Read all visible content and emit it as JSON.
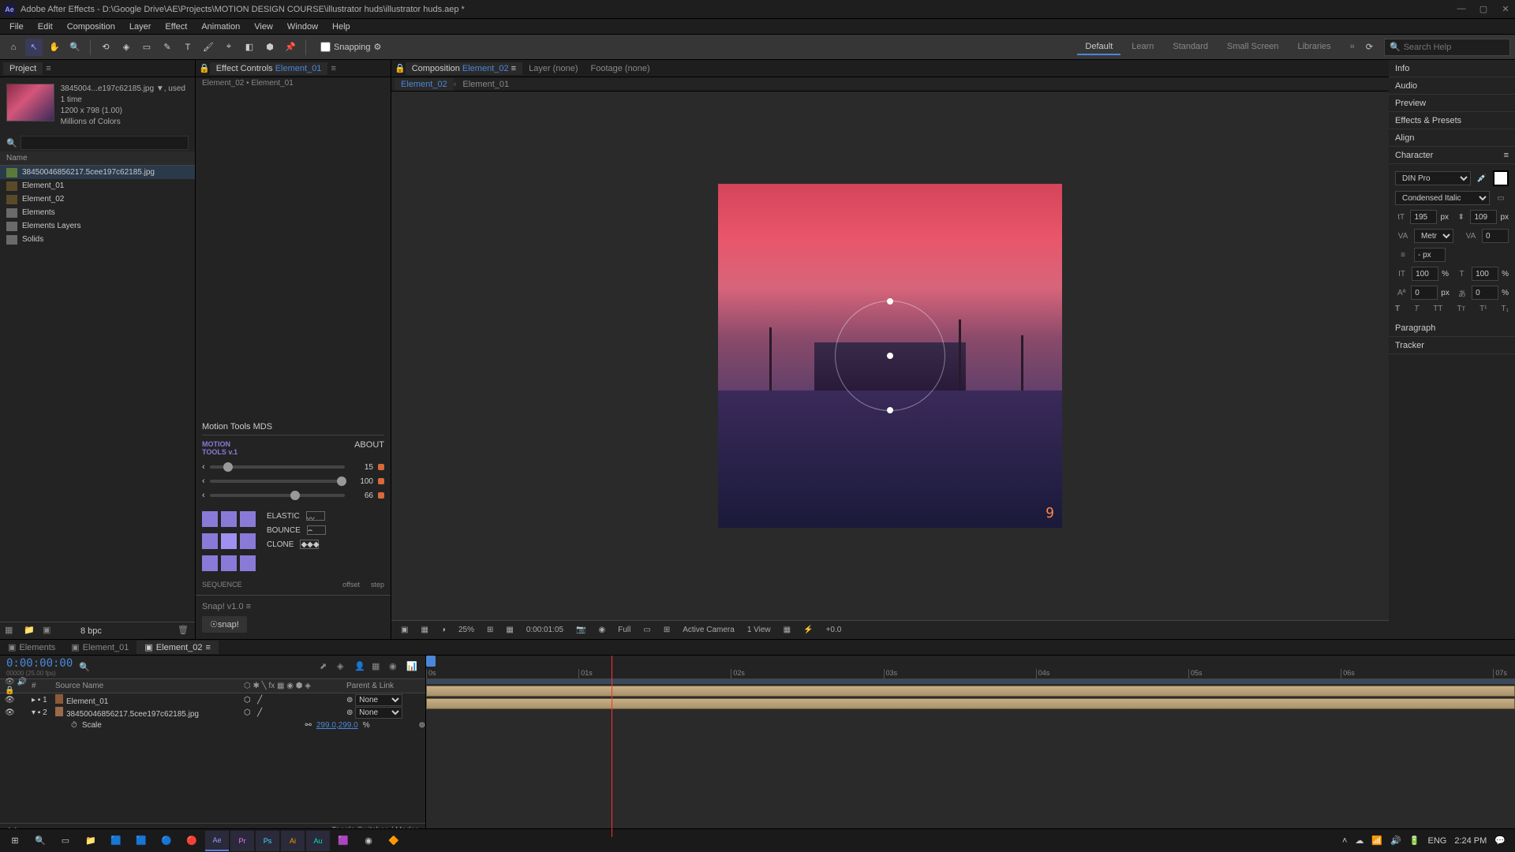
{
  "window": {
    "title": "Adobe After Effects - D:\\Google Drive\\AE\\Projects\\MOTION DESIGN COURSE\\illustrator huds\\illustrator huds.aep *",
    "app_icon": "Ae"
  },
  "menu": [
    "File",
    "Edit",
    "Composition",
    "Layer",
    "Effect",
    "Animation",
    "View",
    "Window",
    "Help"
  ],
  "toolbar": {
    "snapping_label": "Snapping"
  },
  "workspaces": [
    "Default",
    "Learn",
    "Standard",
    "Small Screen",
    "Libraries"
  ],
  "search_placeholder": "Search Help",
  "project": {
    "tab_label": "Project",
    "thumb_name": "3845004...e197c62185.jpg ▼",
    "thumb_info1": ", used 1 time",
    "thumb_info2": "1200 x 798 (1.00)",
    "thumb_info3": "Millions of Colors",
    "list_header": "Name",
    "items": [
      {
        "name": "38450046856217.5cee197c62185.jpg",
        "type": "img",
        "selected": true
      },
      {
        "name": "Element_01",
        "type": "comp"
      },
      {
        "name": "Element_02",
        "type": "comp"
      },
      {
        "name": "Elements",
        "type": "folder"
      },
      {
        "name": "Elements Layers",
        "type": "folder"
      },
      {
        "name": "Solids",
        "type": "folder"
      }
    ],
    "footer_bpc": "8 bpc"
  },
  "fx": {
    "tab_label": "Effect Controls",
    "tab_context": "Element_01",
    "breadcrumb": "Element_02 • Element_01"
  },
  "motion_tools": {
    "title": "Motion Tools MDS",
    "logo_l1": "MOTION",
    "logo_l2": "TOOLS v.1",
    "about": "ABOUT",
    "rows": [
      {
        "val": "15",
        "pos": 10
      },
      {
        "val": "100",
        "pos": 98
      },
      {
        "val": "66",
        "pos": 60
      }
    ],
    "presets": [
      "ELASTIC",
      "BOUNCE",
      "CLONE"
    ],
    "seq_label1": "offset",
    "seq_label2": "step",
    "seq_title": "SEQUENCE"
  },
  "snap": {
    "title": "Snap! v1.0",
    "btn": "☉snap!"
  },
  "comp_tabs": {
    "comp_label": "Composition",
    "comp_active": "Element_02",
    "layer_label": "Layer (none)",
    "footage_label": "Footage (none)",
    "sub1": "Element_02",
    "sub2": "Element_01"
  },
  "comp_footer": {
    "zoom": "25%",
    "time": "0:00:01:05",
    "res": "Full",
    "camera": "Active Camera",
    "views": "1 View",
    "exposure": "+0.0"
  },
  "side_panels": [
    "Info",
    "Audio",
    "Preview",
    "Effects & Presets",
    "Align"
  ],
  "character": {
    "title": "Character",
    "font": "DIN Pro",
    "style": "Condensed Italic",
    "size": "195",
    "leading": "109",
    "size_unit": "px",
    "kerning": "Metrics",
    "tracking": "0",
    "px_unit": "- px",
    "hscale": "100",
    "vscale": "100",
    "baseline": "0",
    "tsume": "0"
  },
  "paragraph": {
    "title": "Paragraph"
  },
  "tracker": {
    "title": "Tracker"
  },
  "timeline": {
    "tabs": [
      "Elements",
      "Element_01",
      "Element_02"
    ],
    "timecode": "0:00:00:00",
    "timecode_sub": "00000 (25.00 fps)",
    "col_source": "Source Name",
    "col_parent": "Parent & Link",
    "marks": [
      "0s",
      "01s",
      "02s",
      "03s",
      "04s",
      "05s",
      "06s",
      "07s"
    ],
    "layers": [
      {
        "idx": "1",
        "name": "Element_01",
        "color": "c1",
        "parent": "None"
      },
      {
        "idx": "2",
        "name": "38450046856217.5cee197c62185.jpg",
        "color": "c2",
        "parent": "None"
      }
    ],
    "prop_scale_label": "Scale",
    "prop_scale_val": "299.0,299.0",
    "prop_scale_unit": "%",
    "footer_toggle": "Toggle Switches / Modes"
  },
  "taskbar": {
    "lang": "ENG",
    "time": "2:24 PM"
  }
}
